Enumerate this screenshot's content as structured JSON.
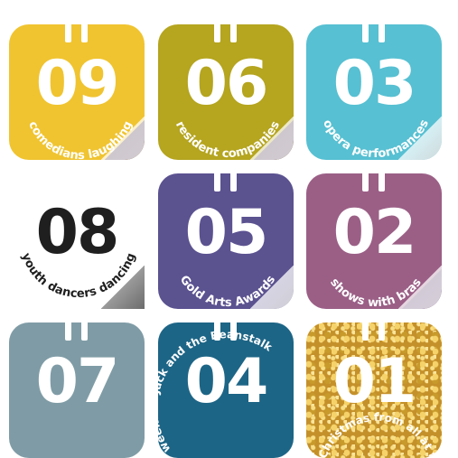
{
  "cards": [
    {
      "number": "09",
      "caption": "comedians laughing",
      "color": "#f0c430"
    },
    {
      "number": "06",
      "caption": "resident companies",
      "color": "#b5a51f"
    },
    {
      "number": "03",
      "caption": "opera performances",
      "color": "#57c0d2"
    },
    {
      "number": "08",
      "caption": "youth dancers dancing",
      "color": "#ffffff"
    },
    {
      "number": "05",
      "caption": "Gold Arts Awards",
      "color": "#5b5290"
    },
    {
      "number": "02",
      "caption": "shows with bras",
      "color": "#9b5f86"
    },
    {
      "number": "07",
      "caption": "",
      "color": "#7f9ca6"
    },
    {
      "number": "04",
      "caption": "weeks of Jack and the Beanstalk",
      "color": "#1d6586"
    },
    {
      "number": "01",
      "caption": "Happy Christmas from all at the Hall",
      "color": "#c4902a"
    }
  ]
}
